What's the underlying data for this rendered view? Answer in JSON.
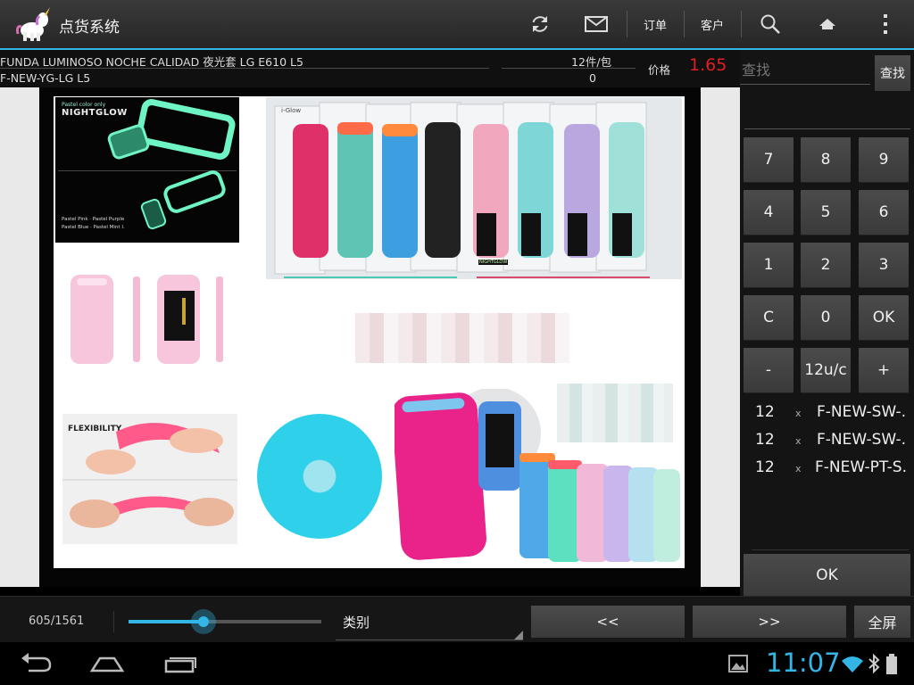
{
  "app": {
    "title": "点货系统",
    "actions": [
      {
        "name": "refresh-button",
        "icon": "refresh-icon"
      },
      {
        "name": "mail-button",
        "icon": "mail-icon"
      },
      {
        "name": "orders-button",
        "label": "订单"
      },
      {
        "name": "customers-button",
        "label": "客户"
      },
      {
        "name": "search-action-button",
        "icon": "search-icon"
      },
      {
        "name": "home-button",
        "icon": "home-icon"
      },
      {
        "name": "overflow-menu-button",
        "icon": "more-vert-icon"
      }
    ]
  },
  "product": {
    "name": "FUNDA LUMINOSO NOCHE CALIDAD 夜光套 LG E610 L5",
    "code": "F-NEW-YG-LG L5",
    "pack": "12件/包",
    "qty": "0",
    "price_label": "价格",
    "price": "1.65"
  },
  "search": {
    "placeholder": "查找",
    "button": "查找"
  },
  "keypad": [
    [
      "7",
      "8",
      "9"
    ],
    [
      "4",
      "5",
      "6"
    ],
    [
      "1",
      "2",
      "3"
    ],
    [
      "C",
      "0",
      "OK"
    ],
    [
      "-",
      "12u/c",
      "+"
    ]
  ],
  "order_list": [
    {
      "qty": "12",
      "x": "x",
      "code": "F-NEW-SW-."
    },
    {
      "qty": "12",
      "x": "x",
      "code": "F-NEW-SW-."
    },
    {
      "qty": "12",
      "x": "x",
      "code": "F-NEW-PT-S."
    }
  ],
  "confirm_button": "OK",
  "pager": {
    "position": "605/1561",
    "progress_percent": 39,
    "category": "类别",
    "prev": "<<",
    "next": ">>",
    "fullscreen": "全屏"
  },
  "product_image": {
    "nightglow_title": "NIGHTGLOW",
    "nightglow_sub": "Pastel color only",
    "nightglow_caption1": "Pastel Pink · Pastel Purple",
    "nightglow_caption2": "Pastel Blue · Pastel Mint I.",
    "brand": "i-Glow",
    "flex_title": "FLEXIBILITY",
    "pack_label": "NIGHTGLOW"
  },
  "status": {
    "time": "11:07"
  },
  "colors": {
    "accent": "#33b5e5",
    "price": "#e02020"
  }
}
